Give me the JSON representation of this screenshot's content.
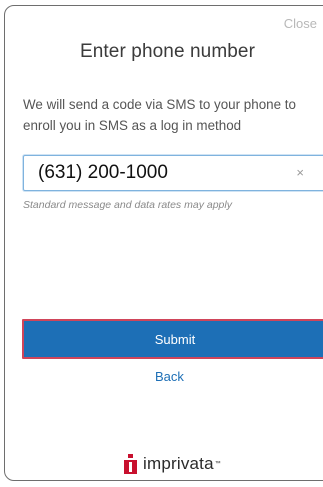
{
  "dialog": {
    "close_label": "Close",
    "title": "Enter phone number",
    "description": "We will send a code via SMS to your phone to enroll you in SMS as a log in method"
  },
  "phone_field": {
    "value": "(631) 200-1000",
    "clear_glyph": "×",
    "hint": "Standard message and data rates may apply"
  },
  "actions": {
    "submit_label": "Submit",
    "back_label": "Back"
  },
  "branding": {
    "logo_text": "imprivata",
    "logo_color": "#c8102e"
  },
  "colors": {
    "primary": "#1d6fb6",
    "submit_outline": "#d0455a",
    "input_focus": "#7fb3de"
  },
  "icons": {
    "clear": "close-x-icon",
    "logo": "imprivata-logo-icon"
  }
}
